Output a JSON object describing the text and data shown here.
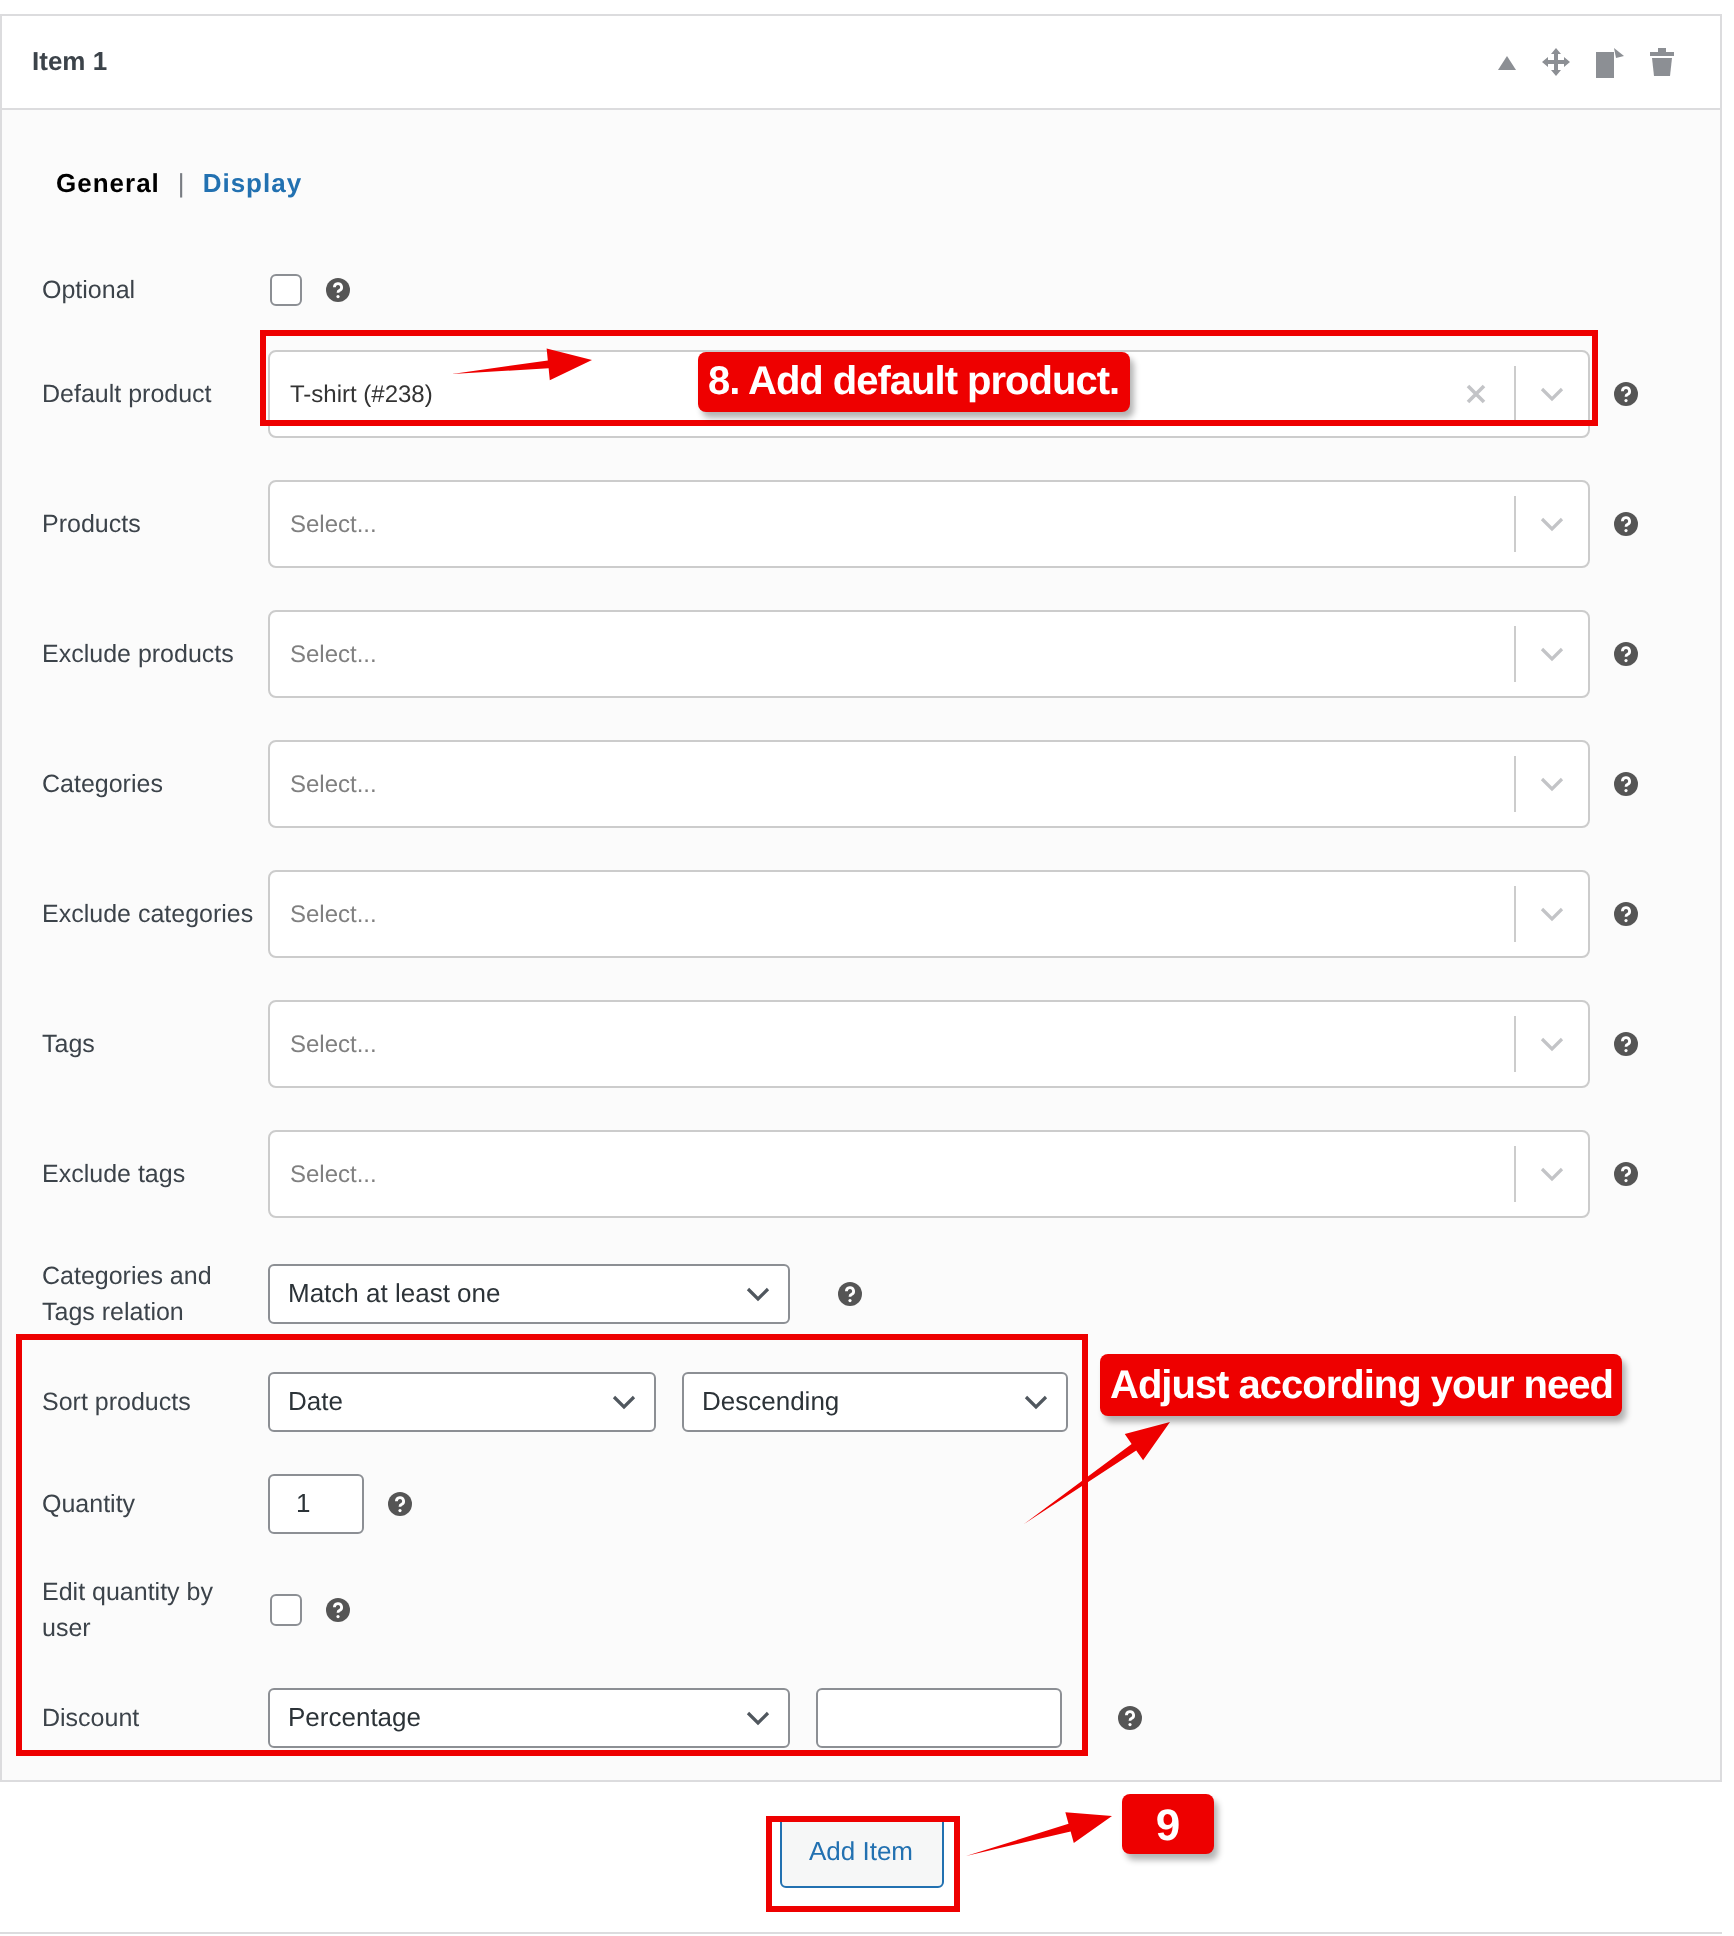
{
  "item": {
    "title": "Item 1"
  },
  "tab_separator": "|",
  "tabs": [
    {
      "label": "General",
      "selected": true
    },
    {
      "label": "Display",
      "selected": false
    }
  ],
  "rows": [
    {
      "kind": "checkbox",
      "label": "Optional",
      "checked": false
    },
    {
      "kind": "multiselect",
      "label": "Default product",
      "value": "T-shirt (#238)"
    },
    {
      "kind": "multiselect",
      "label": "Products",
      "placeholder": "Select..."
    },
    {
      "kind": "multiselect",
      "label": "Exclude products",
      "placeholder": "Select..."
    },
    {
      "kind": "multiselect",
      "label": "Categories",
      "placeholder": "Select..."
    },
    {
      "kind": "multiselect",
      "label": "Exclude categories",
      "placeholder": "Select..."
    },
    {
      "kind": "multiselect",
      "label": "Tags",
      "placeholder": "Select..."
    },
    {
      "kind": "multiselect",
      "label": "Exclude tags",
      "placeholder": "Select..."
    },
    {
      "kind": "select",
      "label": "Categories and Tags relation",
      "value": "Match at least one"
    },
    {
      "kind": "sort",
      "label": "Sort products",
      "values": [
        "Date",
        "Descending"
      ]
    },
    {
      "kind": "number",
      "label": "Quantity",
      "value": "1"
    },
    {
      "kind": "checkbox",
      "label": "Edit quantity by user",
      "checked": false
    },
    {
      "kind": "discount",
      "label": "Discount",
      "value": "Percentage"
    }
  ],
  "add_button": {
    "label": "Add Item"
  },
  "annotations": [
    {
      "kind": "callout",
      "text": "8. Add default product."
    },
    {
      "kind": "callout",
      "text": "Adjust according your need"
    },
    {
      "kind": "badge",
      "text": "9"
    }
  ]
}
